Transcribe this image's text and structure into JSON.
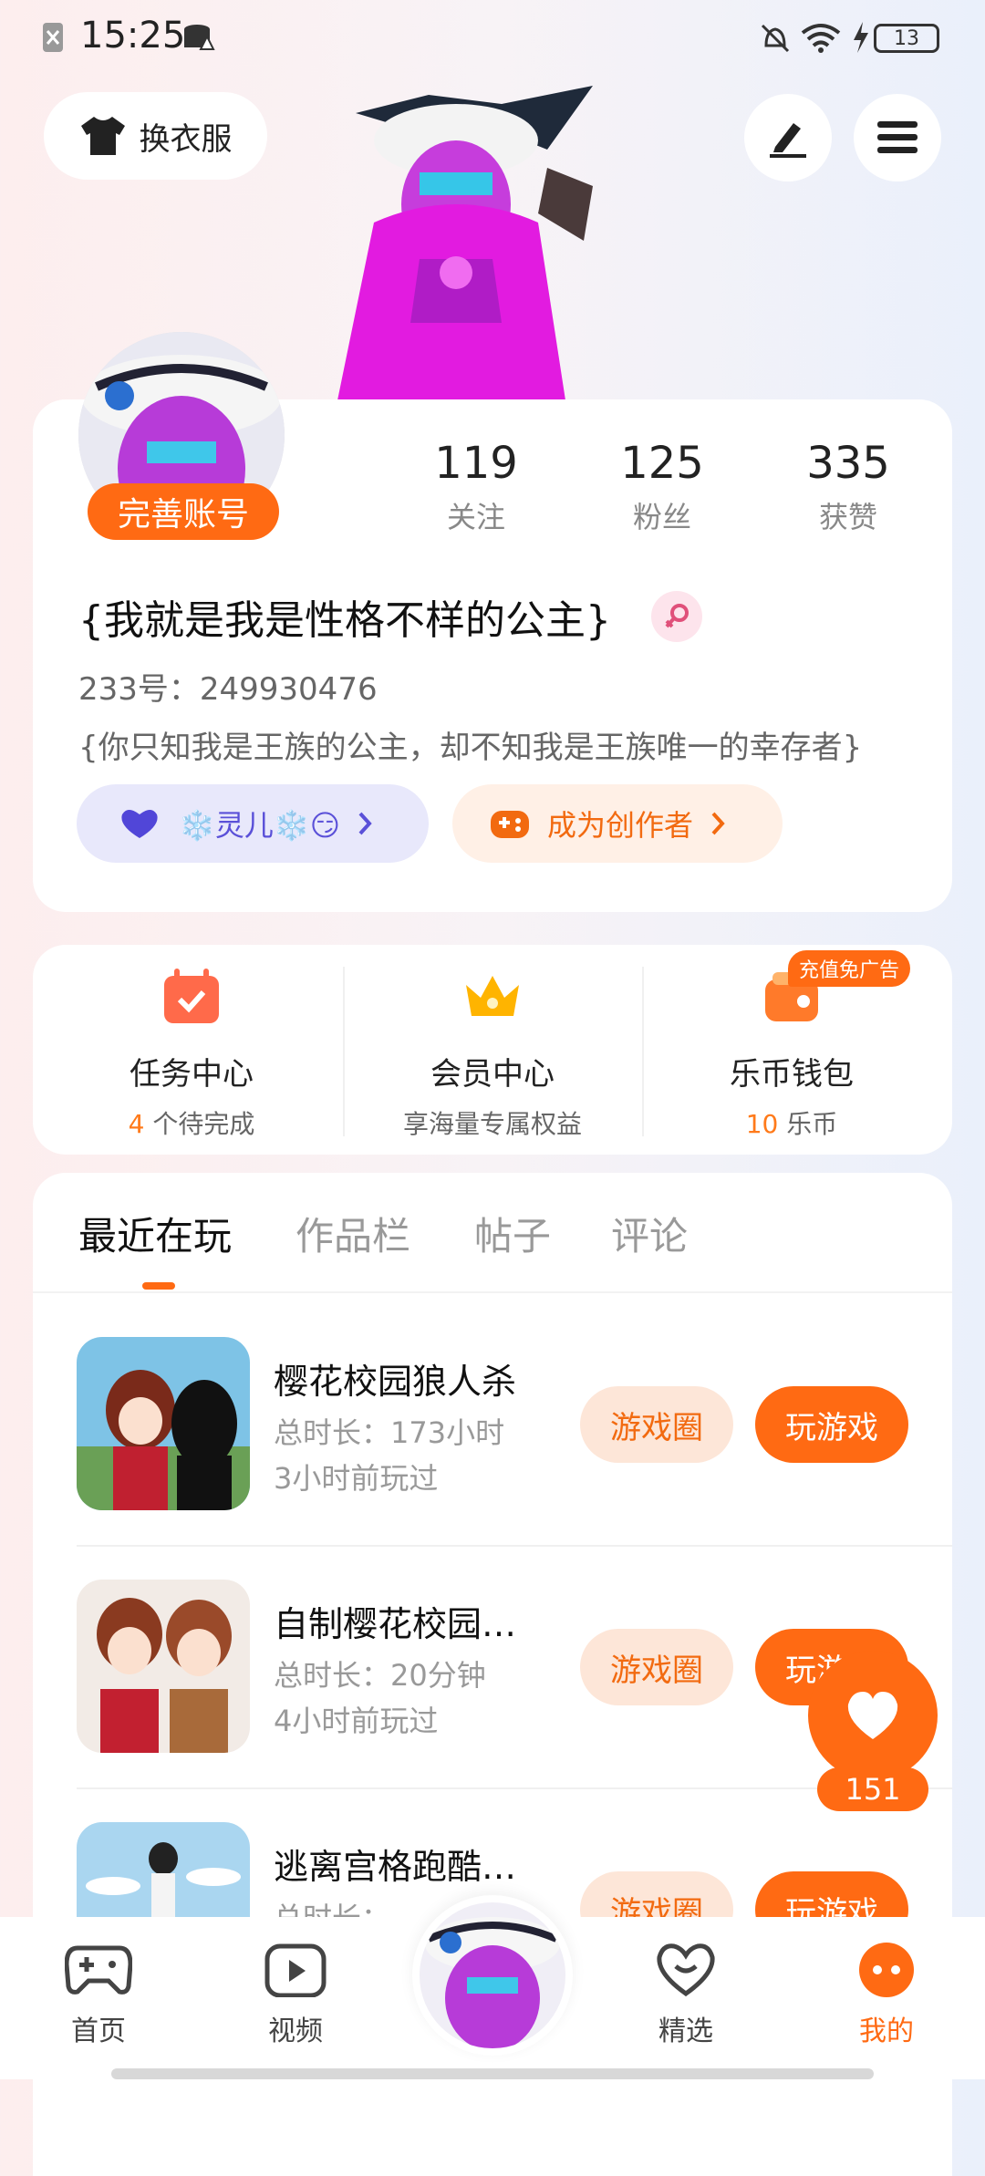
{
  "status_bar": {
    "time": "15:25",
    "battery": "13"
  },
  "header": {
    "outfit_label": "换衣服"
  },
  "profile": {
    "complete_label": "完善账号",
    "stats": [
      {
        "value": "119",
        "label": "关注"
      },
      {
        "value": "125",
        "label": "粉丝"
      },
      {
        "value": "335",
        "label": "获赞"
      }
    ],
    "nickname": "{我就是我是性格不样的公主}",
    "uid": "233号：249930476",
    "bio": "{你只知我是王族的公主，却不知我是王族唯一的幸存者}",
    "fans_chip": "❄️灵儿❄️😏",
    "creator_chip": "成为创作者"
  },
  "services": [
    {
      "title": "任务中心",
      "sub_num": "4",
      "sub_text": " 个待完成"
    },
    {
      "title": "会员中心",
      "sub_num": "",
      "sub_text": "享海量专属权益"
    },
    {
      "title": "乐币钱包",
      "sub_num": "10",
      "sub_text": " 乐币"
    }
  ],
  "ad_badge": "充值免广告",
  "tabs": [
    "最近在玩",
    "作品栏",
    "帖子",
    "评论"
  ],
  "games": [
    {
      "title": "樱花校园狼人杀",
      "duration": "总时长：173小时",
      "last": "3小时前玩过",
      "circle": "游戏圈",
      "play": "玩游戏"
    },
    {
      "title": "自制樱花校园…",
      "duration": "总时长：20分钟",
      "last": "4小时前玩过",
      "circle": "游戏圈",
      "play": "玩游戏"
    },
    {
      "title": "逃离宫格跑酷…",
      "duration": "总时长：",
      "last": "",
      "circle": "游戏圈",
      "play": "玩游戏"
    }
  ],
  "like": {
    "count": "151"
  },
  "nav": [
    {
      "label": "首页"
    },
    {
      "label": "视频"
    },
    {
      "label": "精选"
    },
    {
      "label": "我的"
    }
  ],
  "colors": {
    "accent": "#ff6a13",
    "chip_purple": "#e8e8fb",
    "chip_orange": "#fff0e6"
  }
}
